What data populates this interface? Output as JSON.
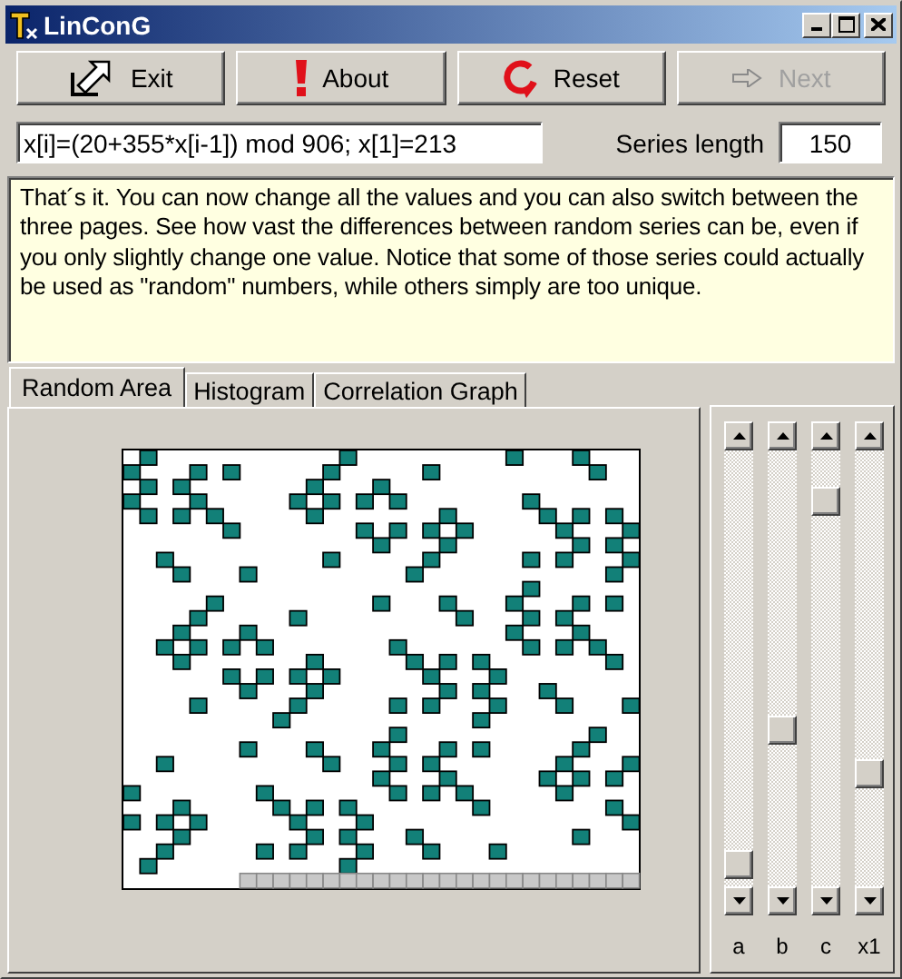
{
  "window": {
    "title": "LinConG"
  },
  "toolbar": [
    {
      "label": "Exit",
      "disabled": false
    },
    {
      "label": "About",
      "disabled": false
    },
    {
      "label": "Reset",
      "disabled": false
    },
    {
      "label": "Next",
      "disabled": true
    }
  ],
  "formula": {
    "value": "x[i]=(20+355*x[i-1]) mod 906; x[1]=213"
  },
  "series_length": {
    "label": "Series length",
    "value": "150"
  },
  "info_text": "That´s it. You can now change all the values and you can also switch between the three pages. See how vast the differences between random series can be, even if you only slightly change one value. Notice that some of those series could actually be used as \"random\" numbers, while others simply are too unique.",
  "tabs": [
    {
      "label": "Random Area",
      "selected": true
    },
    {
      "label": "Histogram",
      "selected": false
    },
    {
      "label": "Correlation Graph",
      "selected": false
    }
  ],
  "sliders": [
    {
      "label": "a"
    },
    {
      "label": "b"
    },
    {
      "label": "c"
    },
    {
      "label": "x1"
    }
  ]
}
